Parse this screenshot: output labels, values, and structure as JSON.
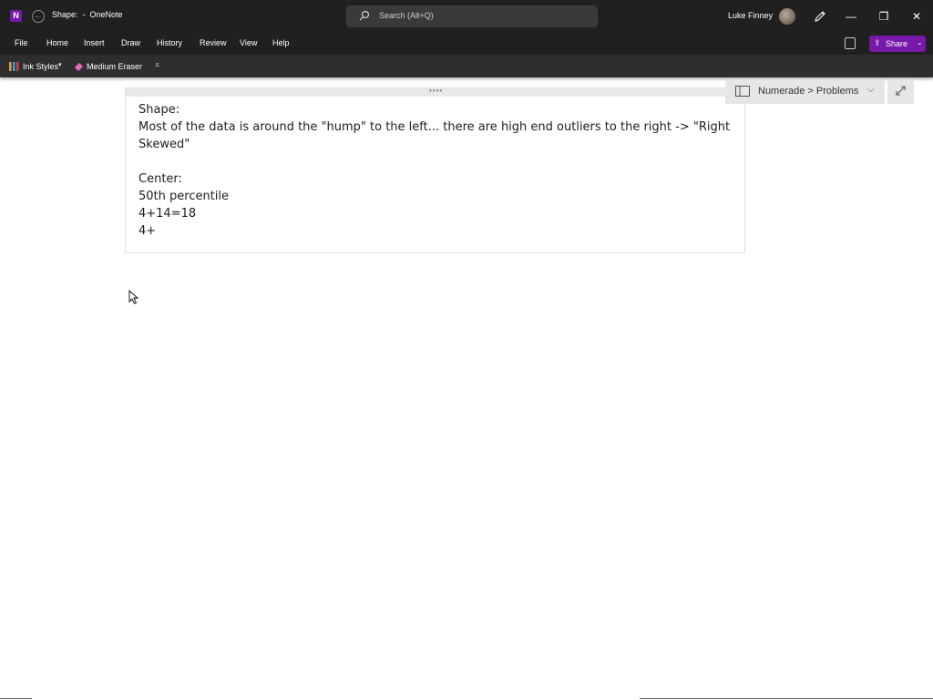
{
  "titlebar": {
    "app_icon_letter": "N",
    "document_title": "Shape:  -  OneNote",
    "search_placeholder": "Search (Alt+Q)",
    "user_name": "Luke Finney",
    "minimize": "—",
    "restore": "❐",
    "close": "✕"
  },
  "menubar": {
    "items": [
      "File",
      "Home",
      "Insert",
      "Draw",
      "History",
      "Review",
      "View",
      "Help"
    ],
    "share_label": "Share"
  },
  "ribbon": {
    "ink_styles_label": "Ink Styles",
    "eraser_label": "Medium Eraser"
  },
  "notebook_nav": {
    "label": "Numerade > Problems"
  },
  "note": {
    "lines": [
      "Shape:",
      "Most of the data is around the \"hump\" to the left... there are high end outliers to the right -> \"Right",
      "Skewed\"",
      "",
      "Center:",
      "50th percentile",
      "4+14=18",
      "4+"
    ]
  },
  "colors": {
    "titlebar_bg": "#202020",
    "ribbon_bg": "#2e2e2e",
    "accent": "#7719aa"
  }
}
